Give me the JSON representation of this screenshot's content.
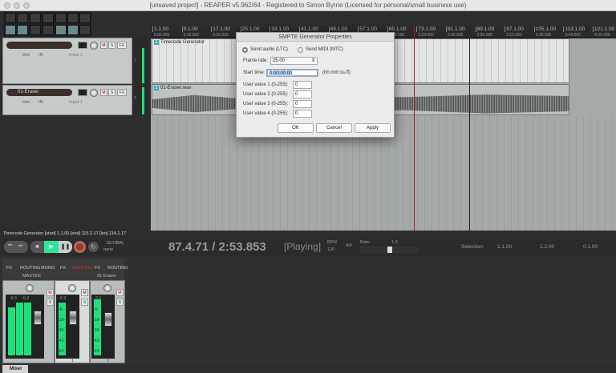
{
  "window": {
    "title": "[unsaved project] - REAPER v5.962/64 - Registered to Simon Byrne (Licensed for personal/small business use)"
  },
  "ruler": {
    "measures": [
      "1.1.00",
      "9.1.00",
      "17.1.00",
      "25.1.00",
      "33.1.00",
      "41.1.00",
      "49.1.00",
      "57.1.00",
      "65.1.00",
      "73.1.00",
      "81.1.00",
      "89.1.00",
      "97.1.00",
      "105.1.00",
      "113.1.00",
      "121.1.00"
    ],
    "times": [
      "0:00.000",
      "0:16.000",
      "0:32.000",
      "0:48.000",
      "1:04.000",
      "1:20.000",
      "1:36.000",
      "1:52.000",
      "2:08.000",
      "2:24.000",
      "2:40.000",
      "2:56.000",
      "3:12.000",
      "3:28.000",
      "3:44.000",
      "4:00.000"
    ]
  },
  "tracks": [
    {
      "name": "",
      "number": "1",
      "input": "Input 1",
      "trim": "trim",
      "in": "IN"
    },
    {
      "name": "01-Eraser",
      "number": "2",
      "input": "Input 1",
      "trim": "trim",
      "in": "IN"
    }
  ],
  "items": [
    {
      "number": "1",
      "name": "Timecode Generator"
    },
    {
      "number": "1",
      "name": "01-Eraser.wav"
    }
  ],
  "dialog": {
    "title": "SMPTE Generator Properties",
    "send_audio": "Send audio (LTC)",
    "send_midi": "Send MIDI (MTC)",
    "selected": "Send audio (LTC)",
    "frame_rate_label": "Frame rate:",
    "frame_rate": "25.00",
    "start_time_label": "Start time:",
    "start_time": "0:00:00:00",
    "start_time_hint": "(hh:mm:ss.ff)",
    "user_values": [
      {
        "label": "User value 1 (0-255):",
        "value": "0"
      },
      {
        "label": "User value 2 (0-255):",
        "value": "0"
      },
      {
        "label": "User value 3 (0-255):",
        "value": "0"
      },
      {
        "label": "User value 4 (0-255):",
        "value": "0"
      }
    ],
    "ok": "OK",
    "cancel": "Cancel",
    "apply": "Apply"
  },
  "status": "Timecode Generator [start] 1.1.00 [end] 115.2.17 [len] 114.1.17",
  "transport": {
    "position": "87.4.71 / 2:53.853",
    "state": "[Playing]",
    "bpm_label": "BPM",
    "bpm": "120",
    "time_sig": "4/4",
    "rate_label": "Rate:",
    "rate": "1.0",
    "global": "GLOBAL",
    "global_mode": "none",
    "selection_label": "Selection:",
    "sel_start": "1.1.00",
    "sel_end": "1.2.00",
    "sel_len": "0.1.00"
  },
  "mixer": {
    "tab": "Mixer",
    "strips": [
      {
        "name": "MASTER",
        "fx": "FX",
        "routing": "ROUTING",
        "mono": "MONO",
        "peaks": [
          "-6.1",
          "-6.2"
        ],
        "number": ""
      },
      {
        "name": "",
        "fx": "FX",
        "routing": "ROUTING",
        "peaks": [
          "-6.9"
        ],
        "number": "1"
      },
      {
        "name": "01-Eraser",
        "fx": "FX",
        "routing": "ROUTING",
        "peaks": [
          "-3.1"
        ],
        "number": "2"
      }
    ],
    "scale": [
      "-6-",
      "-18-",
      "-30-",
      "-42-",
      "-54-"
    ]
  },
  "colors": {
    "accent_green": "#1ee07a",
    "playhead": "#a02020",
    "play_button": "#2ee59d"
  }
}
